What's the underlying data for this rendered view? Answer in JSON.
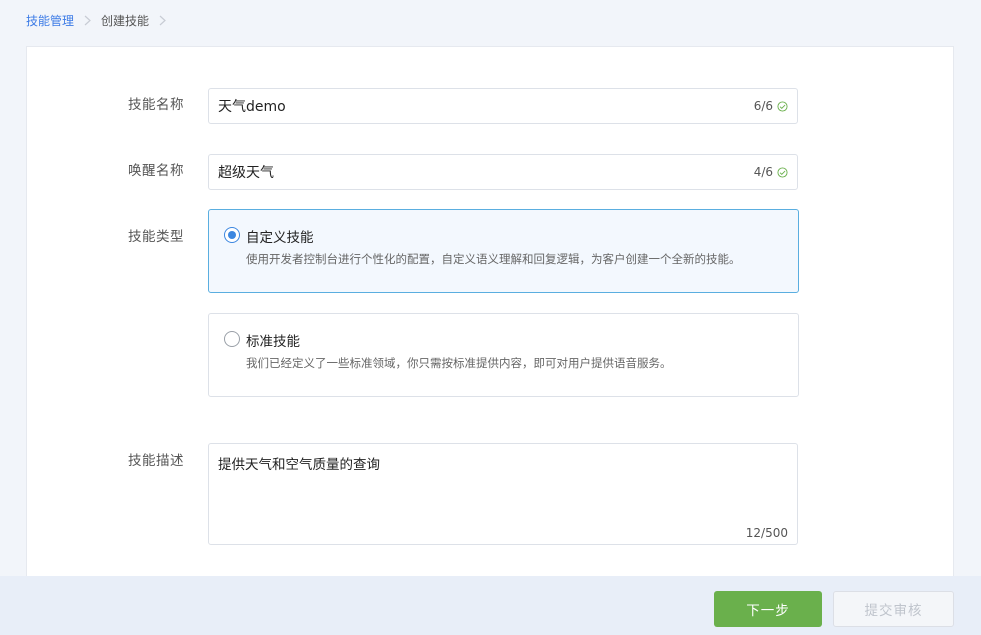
{
  "breadcrumb": {
    "items": [
      "技能管理",
      "创建技能"
    ]
  },
  "form": {
    "skill_name": {
      "label": "技能名称",
      "value": "天气demo",
      "count": "6/6"
    },
    "wake_name": {
      "label": "唤醒名称",
      "value": "超级天气",
      "count": "4/6"
    },
    "skill_type": {
      "label": "技能类型",
      "options": [
        {
          "title": "自定义技能",
          "description": "使用开发者控制台进行个性化的配置，自定义语义理解和回复逻辑，为客户创建一个全新的技能。",
          "selected": true
        },
        {
          "title": "标准技能",
          "description": "我们已经定义了一些标准领域，你只需按标准提供内容，即可对用户提供语音服务。",
          "selected": false
        }
      ]
    },
    "description": {
      "label": "技能描述",
      "value": "提供天气和空气质量的查询",
      "count": "12/500"
    }
  },
  "footer": {
    "next_label": "下一步",
    "submit_label": "提交审核"
  },
  "colors": {
    "accent": "#3c87e0",
    "primary_button": "#6ab04c",
    "valid_check": "#6ab04c"
  },
  "icons": [
    "chevron-right-icon",
    "check-circle-icon",
    "radio-icon"
  ]
}
